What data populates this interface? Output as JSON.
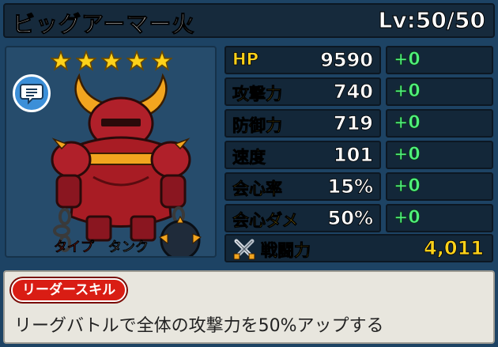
{
  "header": {
    "name": "ビッグアーマー火",
    "level": "Lv:50/50"
  },
  "portrait": {
    "stars": 5,
    "type_label": "タイプ",
    "type_value": "タンク"
  },
  "stats": [
    {
      "label": "HP",
      "value": "9590",
      "bonus": "+0"
    },
    {
      "label": "攻撃力",
      "value": "740",
      "bonus": "+0"
    },
    {
      "label": "防御力",
      "value": "719",
      "bonus": "+0"
    },
    {
      "label": "速度",
      "value": "101",
      "bonus": "+0"
    },
    {
      "label": "会心率",
      "value": "15%",
      "bonus": "+0"
    },
    {
      "label": "会心ダメ",
      "value": "50%",
      "bonus": "+0"
    }
  ],
  "power": {
    "label": "戦闘力",
    "value": "4,011"
  },
  "skill": {
    "badge": "リーダースキル",
    "description": "リーグバトルで全体の攻撃力を50%アップする"
  },
  "colors": {
    "star": "#ffd21a",
    "stat_label": "#ffd21a",
    "bonus": "#4ff07c",
    "badge": "#d91d14",
    "type_label": "#e23a2f"
  }
}
